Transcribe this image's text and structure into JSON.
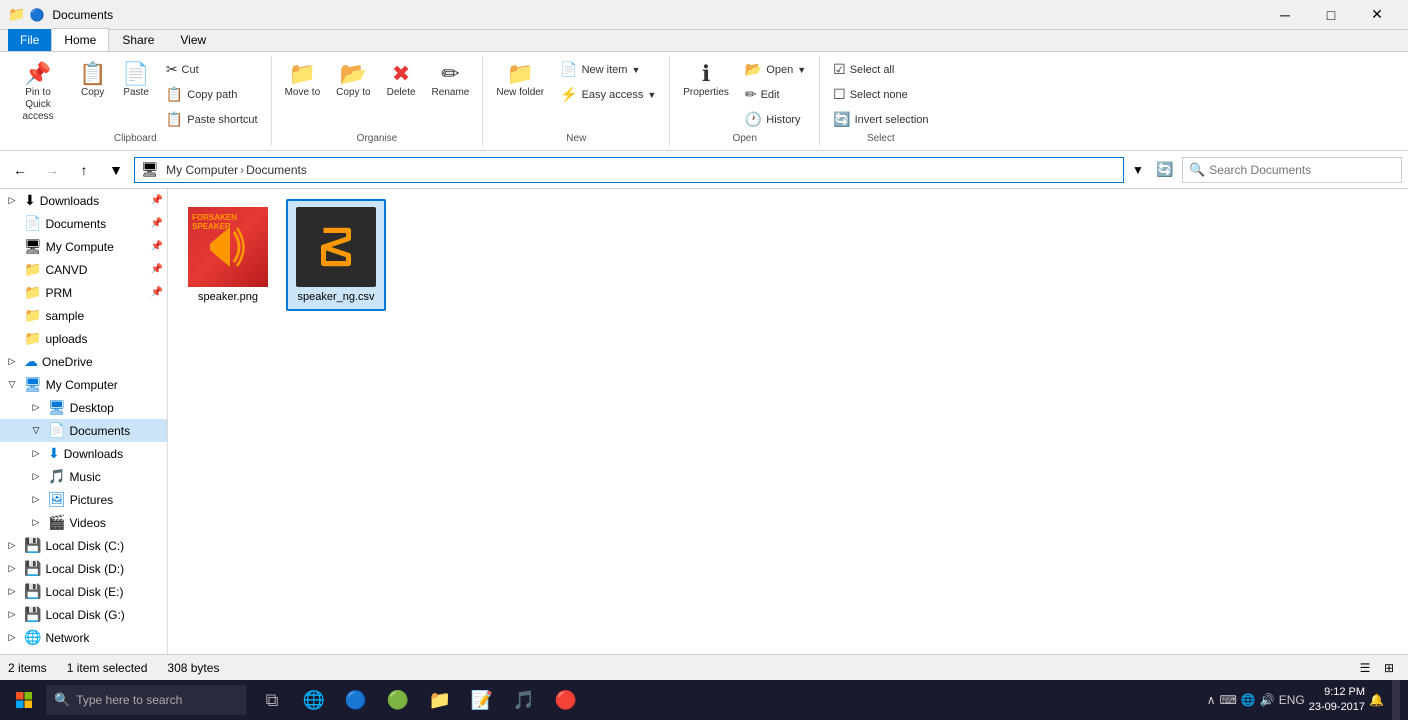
{
  "window": {
    "title": "Documents",
    "icon": "📁"
  },
  "titlebar": {
    "title": "Documents",
    "minimize": "─",
    "maximize": "□",
    "close": "✕"
  },
  "ribbon": {
    "tabs": [
      "File",
      "Home",
      "Share",
      "View"
    ],
    "active_tab": "Home",
    "groups": {
      "clipboard": {
        "label": "Clipboard",
        "pin_label": "Pin to Quick access",
        "copy_label": "Copy",
        "paste_label": "Paste",
        "cut_label": "Cut",
        "copy_path_label": "Copy path",
        "paste_shortcut_label": "Paste shortcut"
      },
      "organise": {
        "label": "Organise",
        "move_to_label": "Move to",
        "copy_to_label": "Copy to",
        "delete_label": "Delete",
        "rename_label": "Rename"
      },
      "new": {
        "label": "New",
        "new_item_label": "New item",
        "easy_access_label": "Easy access",
        "new_folder_label": "New folder"
      },
      "open": {
        "label": "Open",
        "open_label": "Open",
        "edit_label": "Edit",
        "history_label": "History",
        "properties_label": "Properties"
      },
      "select": {
        "label": "Select",
        "select_all_label": "Select all",
        "select_none_label": "Select none",
        "invert_selection_label": "Invert selection"
      }
    }
  },
  "addressbar": {
    "path_parts": [
      "My Computer",
      "Documents"
    ],
    "search_placeholder": "Search Documents"
  },
  "sidebar": {
    "quick_access": [
      {
        "label": "Downloads",
        "pinned": true,
        "icon": "⬇",
        "indent": 0
      },
      {
        "label": "Documents",
        "pinned": true,
        "icon": "📄",
        "indent": 0
      },
      {
        "label": "My Compute",
        "pinned": true,
        "icon": "🖥",
        "indent": 0
      },
      {
        "label": "CANVD",
        "pinned": true,
        "icon": "📁",
        "indent": 0
      },
      {
        "label": "PRM",
        "pinned": true,
        "icon": "📁",
        "indent": 0
      },
      {
        "label": "sample",
        "icon": "📁",
        "indent": 0
      },
      {
        "label": "uploads",
        "icon": "📁",
        "indent": 0
      }
    ],
    "onedrive": {
      "label": "OneDrive",
      "icon": "☁"
    },
    "my_computer": {
      "label": "My Computer",
      "icon": "🖥",
      "items": [
        {
          "label": "Desktop",
          "icon": "🖥",
          "indent": 1
        },
        {
          "label": "Documents",
          "icon": "📄",
          "indent": 1,
          "selected": true
        },
        {
          "label": "Downloads",
          "icon": "⬇",
          "indent": 1
        },
        {
          "label": "Music",
          "icon": "🎵",
          "indent": 1
        },
        {
          "label": "Pictures",
          "icon": "🖼",
          "indent": 1
        },
        {
          "label": "Videos",
          "icon": "🎬",
          "indent": 1
        }
      ],
      "drives": [
        {
          "label": "Local Disk (C:)",
          "icon": "💾"
        },
        {
          "label": "Local Disk (D:)",
          "icon": "💾"
        },
        {
          "label": "Local Disk (E:)",
          "icon": "💾"
        },
        {
          "label": "Local Disk (G:)",
          "icon": "💾"
        }
      ]
    },
    "network": {
      "label": "Network",
      "icon": "🌐"
    }
  },
  "files": [
    {
      "name": "speaker.png",
      "type": "png",
      "selected": false
    },
    {
      "name": "speaker_ng.csv",
      "type": "csv",
      "selected": true
    }
  ],
  "statusbar": {
    "count": "2 items",
    "selected": "1 item selected",
    "size": "308 bytes"
  },
  "taskbar": {
    "search_placeholder": "Type here to search",
    "clock": "9:12 PM",
    "date": "23-09-2017",
    "lang": "ENG"
  }
}
